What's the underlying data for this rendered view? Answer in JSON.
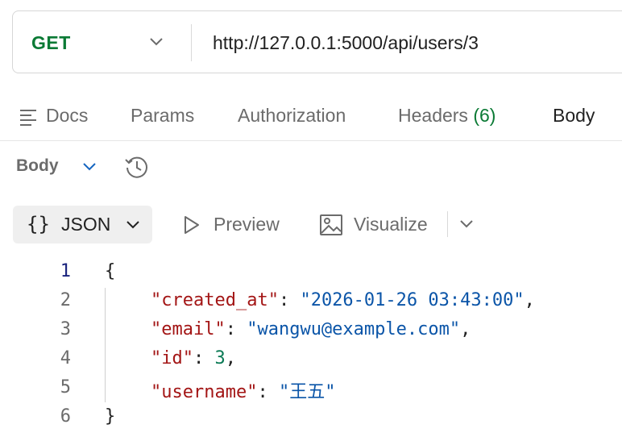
{
  "request": {
    "method": "GET",
    "url": "http://127.0.0.1:5000/api/users/3"
  },
  "tabs": [
    {
      "label": "Docs"
    },
    {
      "label": "Params"
    },
    {
      "label": "Authorization"
    },
    {
      "label": "Headers",
      "count": "(6)"
    },
    {
      "label": "Body",
      "active": true
    }
  ],
  "response": {
    "section_label": "Body",
    "format_label": "JSON",
    "format_icon": "{}",
    "preview_label": "Preview",
    "visualize_label": "Visualize"
  },
  "json_lines": [
    {
      "n": "1"
    },
    {
      "n": "2",
      "key": "\"created_at\"",
      "value": "\"2026-01-26 03:43:00\"",
      "value_type": "string",
      "trail": ","
    },
    {
      "n": "3",
      "key": "\"email\"",
      "value": "\"wangwu@example.com\"",
      "value_type": "string",
      "trail": ","
    },
    {
      "n": "4",
      "key": "\"id\"",
      "value": "3",
      "value_type": "number",
      "trail": ","
    },
    {
      "n": "5",
      "key": "\"username\"",
      "value": "\"王五\"",
      "value_type": "string",
      "trail": ""
    },
    {
      "n": "6"
    }
  ],
  "brace_open": "{",
  "brace_close": "}",
  "colors": {
    "method_get": "#0b7a35",
    "json_key": "#a31515",
    "json_string": "#0b55a8",
    "json_number": "#0b7a55"
  }
}
